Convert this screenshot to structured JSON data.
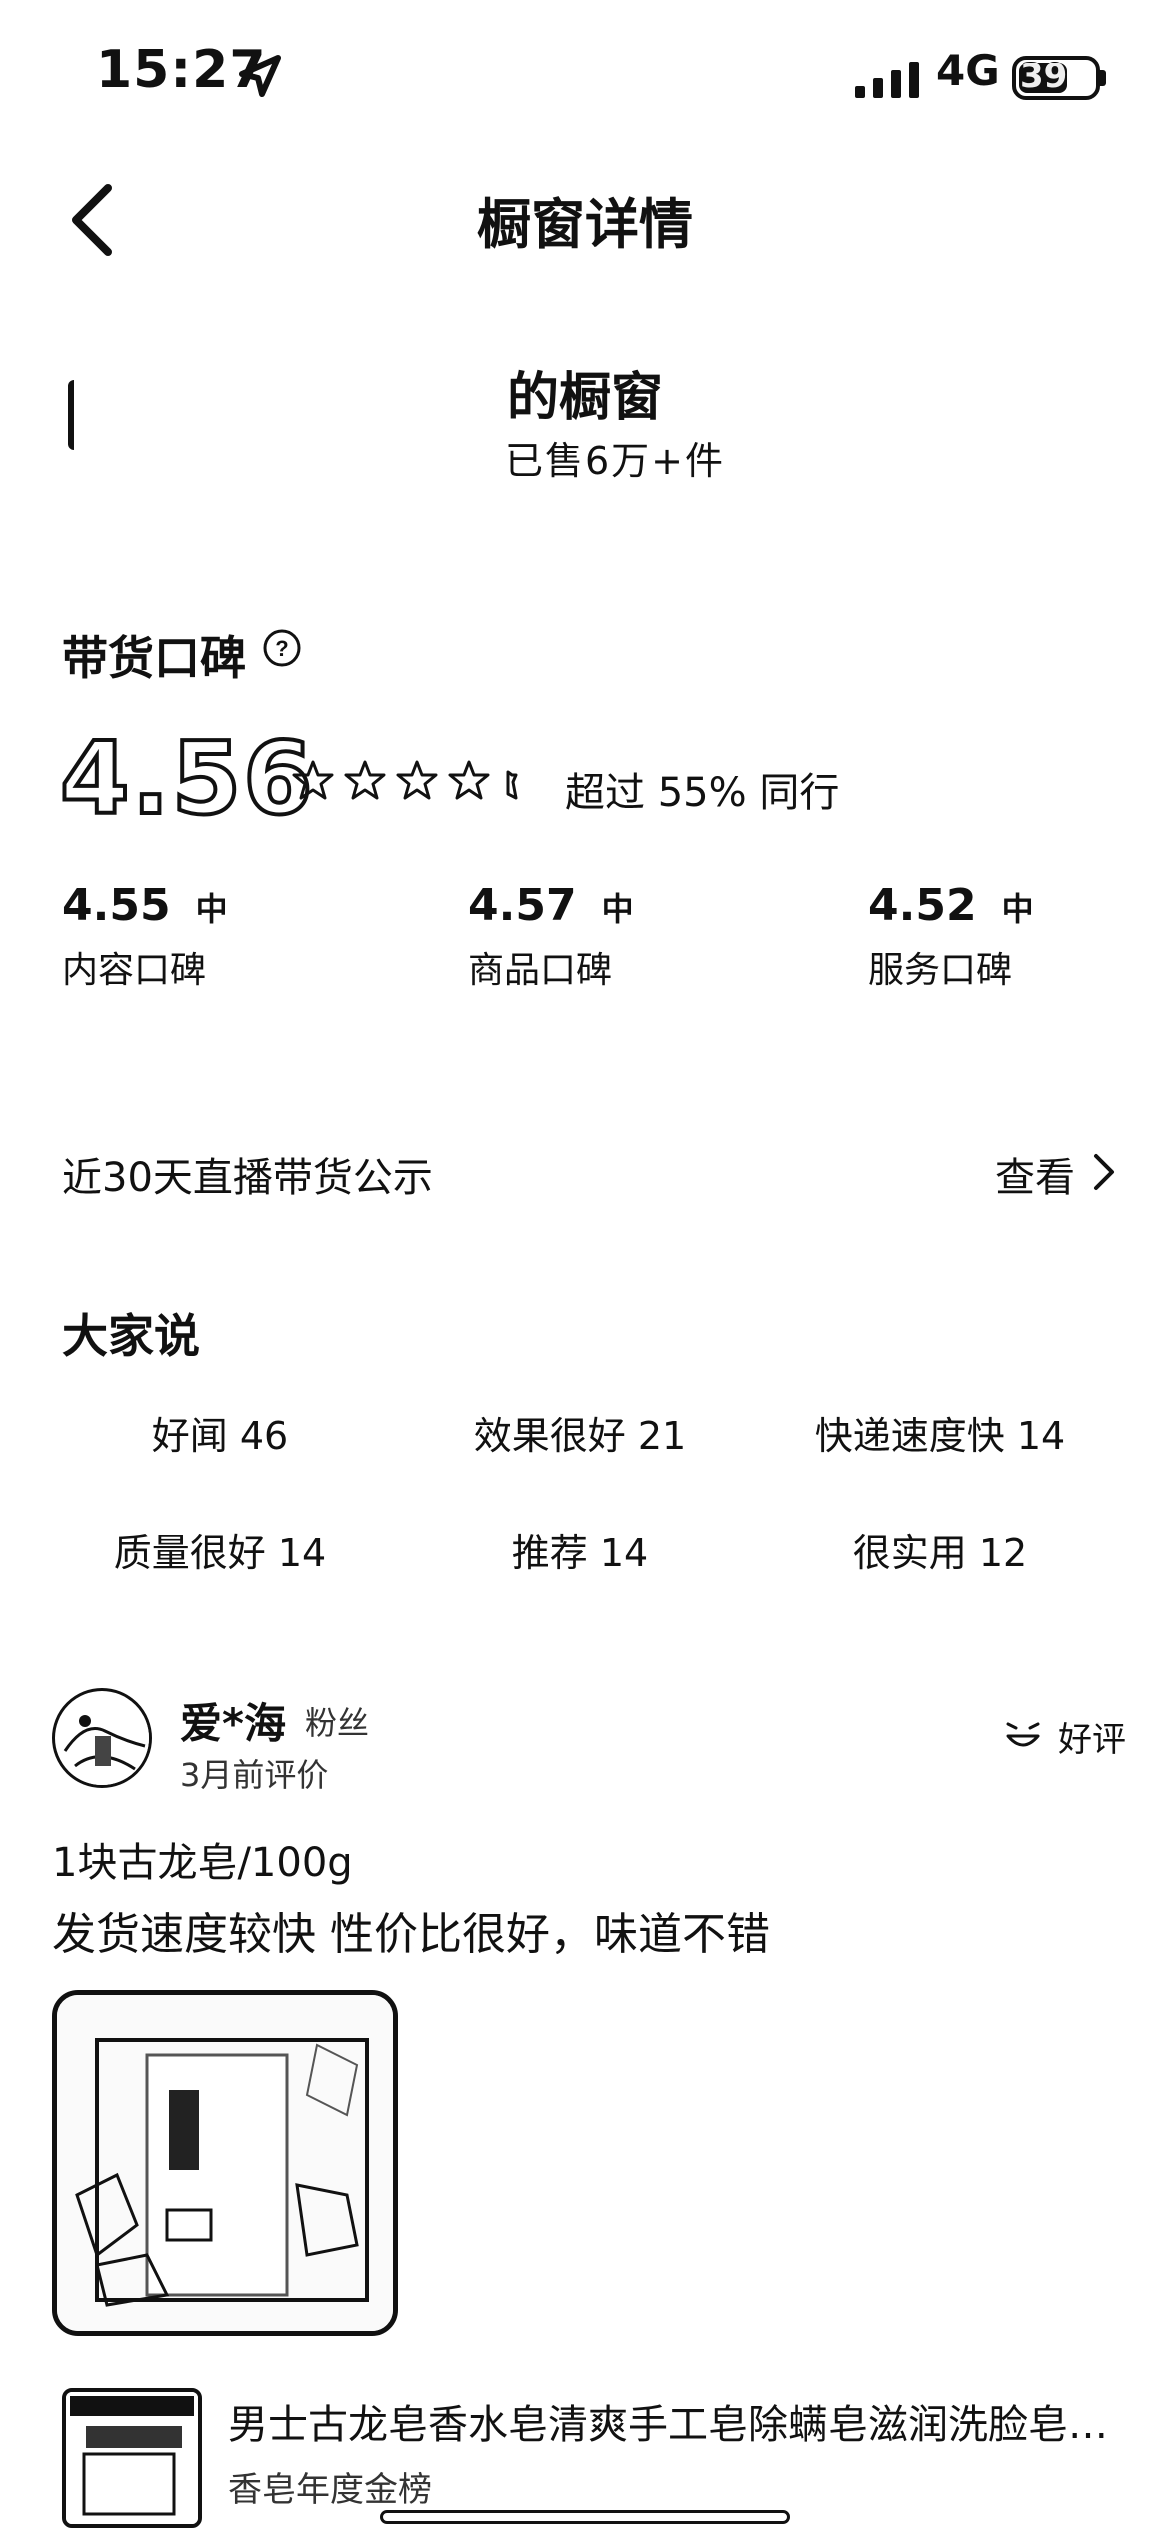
{
  "status_bar": {
    "time": "15:27",
    "network": "4G",
    "battery": "39"
  },
  "header": {
    "title": "橱窗详情"
  },
  "shop": {
    "name": "的橱窗",
    "sales": "已售6万+件"
  },
  "reputation": {
    "title": "带货口碑",
    "score": "4.56",
    "stars": 4.5,
    "exceed": "超过 55% 同行",
    "sub": [
      {
        "score": "4.55",
        "level": "中",
        "label": "内容口碑"
      },
      {
        "score": "4.57",
        "level": "中",
        "label": "商品口碑"
      },
      {
        "score": "4.52",
        "level": "中",
        "label": "服务口碑"
      }
    ]
  },
  "live": {
    "label": "近30天直播带货公示",
    "view": "查看"
  },
  "everyone_says": {
    "title": "大家说",
    "tags": [
      "好闻 46",
      "效果很好 21",
      "快递速度快 14",
      "质量很好 14",
      "推荐 14",
      "很实用 12"
    ]
  },
  "review": {
    "user": "爱*海",
    "fan_tag": "粉丝",
    "time": "3月前评价",
    "rating_label": "好评",
    "spec": "1块古龙皂/100g",
    "text": "发货速度较快 性价比很好，味道不错"
  },
  "product": {
    "title": "男士古龙皂香水皂清爽手工皂除螨皂滋润洗脸皂精…",
    "tag": "香皂年度金榜"
  }
}
